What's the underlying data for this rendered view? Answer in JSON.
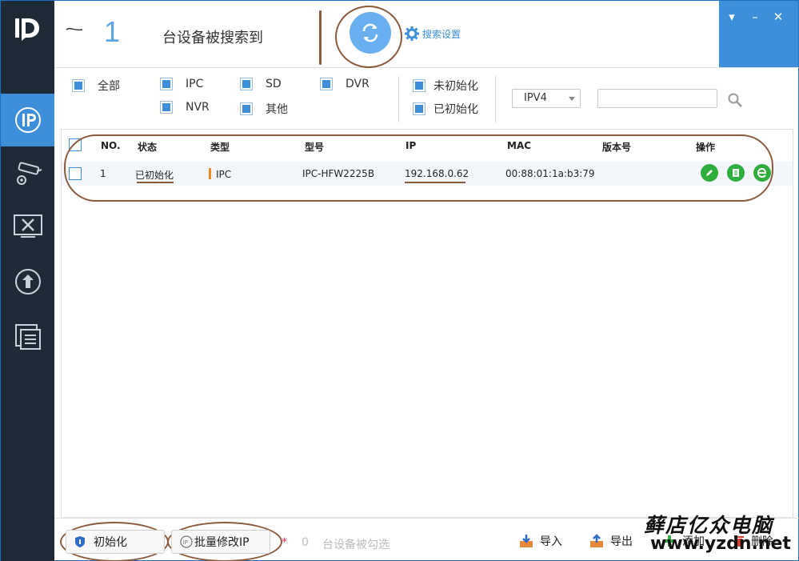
{
  "header": {
    "found_count": "1",
    "found_label": "台设备被搜索到",
    "search_settings": "搜索设置"
  },
  "window_controls": {
    "menu": "▾",
    "minimize": "–",
    "close": "✕"
  },
  "sidebar": {
    "items": [
      {
        "icon": "ip-icon"
      },
      {
        "icon": "camera-settings-icon"
      },
      {
        "icon": "tools-icon"
      },
      {
        "icon": "upgrade-icon"
      },
      {
        "icon": "document-list-icon"
      }
    ]
  },
  "filters": {
    "device_types": [
      "全部",
      "IPC",
      "SD",
      "DVR",
      "NVR",
      "其他"
    ],
    "init_states": [
      "未初始化",
      "已初始化"
    ],
    "ip_version": "IPV4",
    "search_value": ""
  },
  "table": {
    "headers": [
      "NO.",
      "状态",
      "类型",
      "型号",
      "IP",
      "MAC",
      "版本号",
      "操作"
    ],
    "rows": [
      {
        "no": "1",
        "status": "已初始化",
        "type": "IPC",
        "model": "IPC-HFW2225B",
        "ip": "192.168.0.62",
        "mac": "00:88:01:1a:b3:79",
        "version": ""
      }
    ]
  },
  "footer": {
    "init_button": "初始化",
    "batch_ip_button": "批量修改IP",
    "selected_star": "*",
    "selected_count": "0",
    "selected_label": "台设备被勾选",
    "import": "导入",
    "export": "导出",
    "add": "添加",
    "delete": "删除"
  },
  "watermark": {
    "line1": "藓店亿众电脑",
    "line2": "www.yzdn.net"
  },
  "colors": {
    "sidebar": "#1e2a36",
    "accent": "#3d8fd9",
    "refresh": "#6ab0f1",
    "op_green": "#2fae3d",
    "type_bar": "#f08a24"
  }
}
